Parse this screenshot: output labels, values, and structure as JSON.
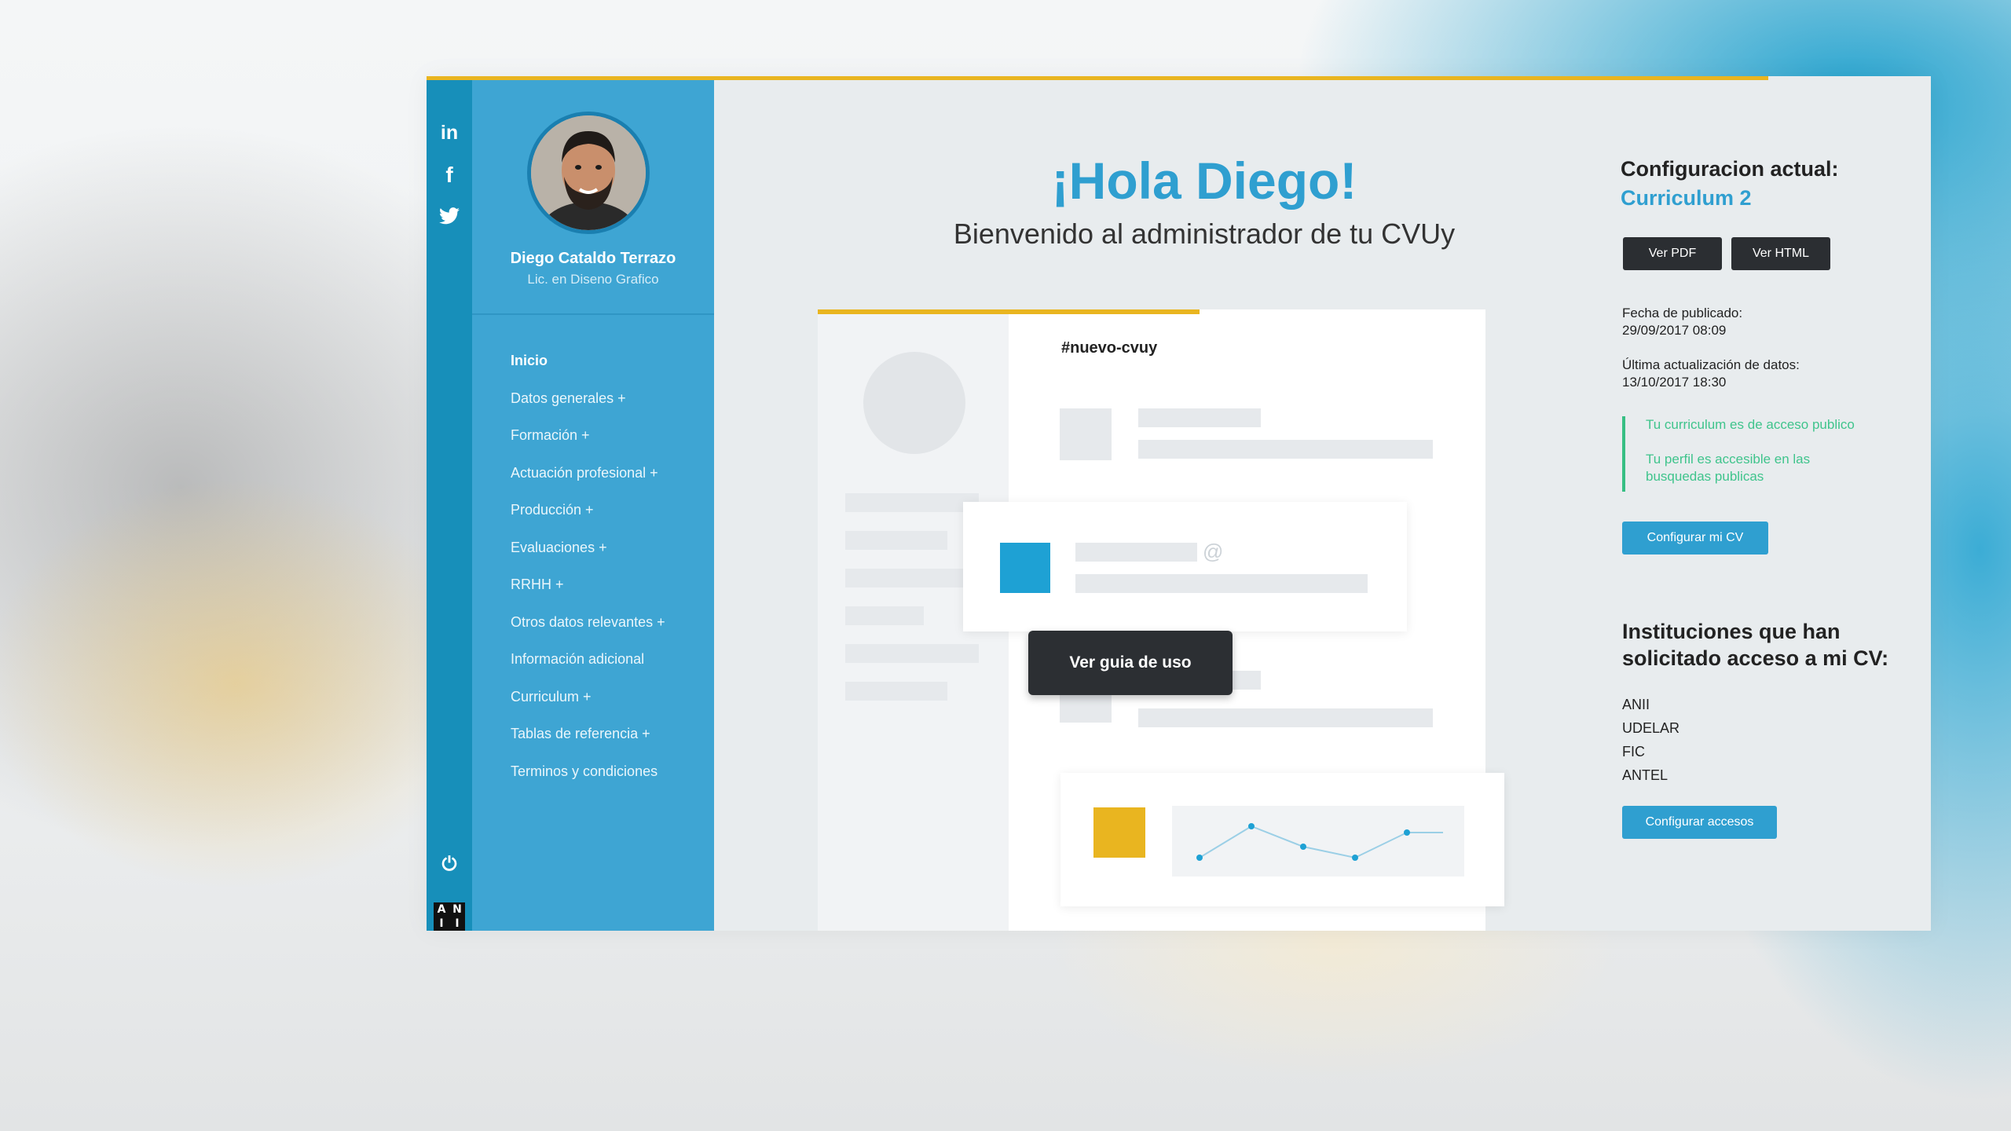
{
  "social": {
    "icons": [
      "linkedin-icon",
      "facebook-icon",
      "twitter-icon",
      "power-icon"
    ],
    "linkedin_glyph": "in",
    "facebook_glyph": "f",
    "power_glyph": "⏻",
    "brand_letters": [
      "A",
      "N",
      "I",
      "I"
    ]
  },
  "profile": {
    "name": "Diego Cataldo Terrazo",
    "title": "Lic. en Diseno Grafico"
  },
  "nav": {
    "items": [
      "Inicio",
      "Datos generales +",
      "Formación +",
      "Actuación profesional +",
      "Producción +",
      "Evaluaciones +",
      "RRHH +",
      "Otros datos relevantes +",
      "Información adicional",
      "Curriculum +",
      "Tablas de referencia +",
      "Terminos y condiciones"
    ],
    "active": "Inicio"
  },
  "main": {
    "greeting": "¡Hola Diego!",
    "welcome": "Bienvenido al administrador de tu CVUy",
    "mock_tag": "#nuevo-cvuy",
    "mock_at": "@",
    "guide_button": "Ver guia de uso"
  },
  "right": {
    "config_title": "Configuracion actual:",
    "config_value": "Curriculum 2",
    "btn_pdf": "Ver PDF",
    "btn_html": "Ver HTML",
    "published_label": "Fecha de publicado:",
    "published_value": "29/09/2017 08:09",
    "updated_label": "Última actualización de datos:",
    "updated_value": "13/10/2017 18:30",
    "status_1": "Tu curriculum es de acceso publico",
    "status_2_line1": "Tu perfil es accesible en las",
    "status_2_line2": "busquedas publicas",
    "btn_configure_cv": "Configurar mi CV",
    "institutions_title": "Instituciones que han solicitado acceso a mi CV:",
    "institutions": [
      "ANII",
      "UDELAR",
      "FIC",
      "ANTEL"
    ],
    "btn_configure_access": "Configurar accesos"
  },
  "colors": {
    "accent_blue": "#2f9fd0",
    "sidebar_blue": "#3ea5d3",
    "strip_blue": "#178fba",
    "accent_yellow": "#e9b520",
    "status_green": "#3fc48c",
    "dark_button": "#2b2e32"
  }
}
